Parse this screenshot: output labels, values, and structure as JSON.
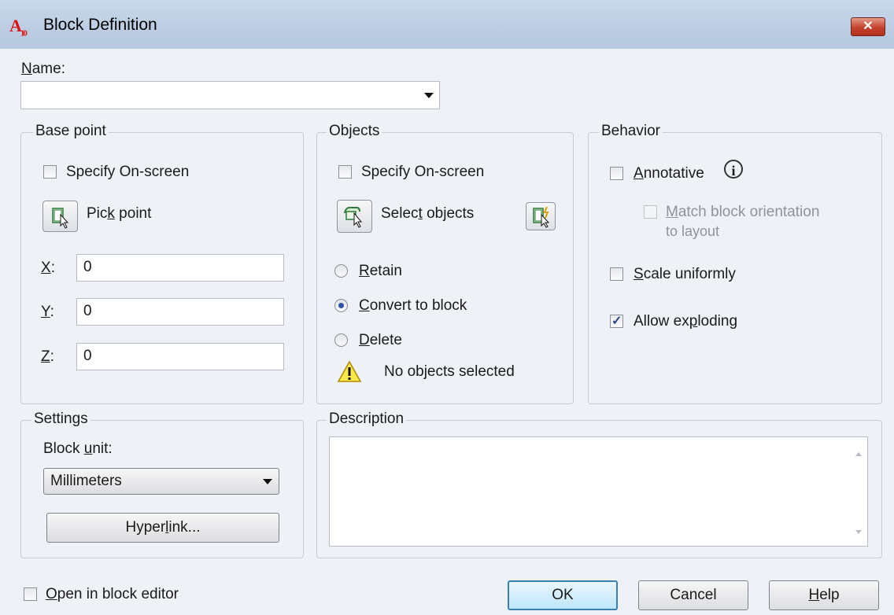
{
  "window": {
    "title": "Block Definition",
    "app_icon_text": "A",
    "app_icon_sub": "10",
    "close_symbol": "✕"
  },
  "name": {
    "label_pre": "",
    "label_u": "N",
    "label_post": "ame:",
    "value": ""
  },
  "base_point": {
    "title": "Base point",
    "specify_label": "Specify On-screen",
    "specify_checked": false,
    "pick_pre": "Pic",
    "pick_u": "k",
    "pick_post": " point",
    "x_u": "X",
    "x_post": ":",
    "x_value": "0",
    "y_u": "Y",
    "y_post": ":",
    "y_value": "0",
    "z_u": "Z",
    "z_post": ":",
    "z_value": "0"
  },
  "objects": {
    "title": "Objects",
    "specify_label": "Specify On-screen",
    "specify_checked": false,
    "select_pre": "Selec",
    "select_u": "t",
    "select_post": " objects",
    "retain_u": "R",
    "retain_post": "etain",
    "convert_u": "C",
    "convert_post": "onvert to block",
    "delete_u": "D",
    "delete_post": "elete",
    "selected_option": "convert",
    "status": "No objects selected"
  },
  "behavior": {
    "title": "Behavior",
    "annotative_u": "A",
    "annotative_post": "nnotative",
    "annotative_checked": false,
    "info_symbol": "i",
    "match_u": "M",
    "match_post": "atch block orientation",
    "match_line2": "to layout",
    "scale_u": "S",
    "scale_post": "cale uniformly",
    "scale_checked": false,
    "explode_pre": "Allow ex",
    "explode_u": "p",
    "explode_post": "loding",
    "explode_checked": true,
    "check_symbol": "✓"
  },
  "settings": {
    "title": "Settings",
    "unit_pre": "Block ",
    "unit_u": "u",
    "unit_post": "nit:",
    "unit_value": "Millimeters",
    "hyperlink_pre": "Hyper",
    "hyperlink_u": "l",
    "hyperlink_post": "ink..."
  },
  "description": {
    "title": "Description",
    "value": ""
  },
  "footer": {
    "open_u": "O",
    "open_post": "pen in block editor",
    "open_checked": false,
    "ok": "OK",
    "cancel": "Cancel",
    "help_u": "H",
    "help_post": "elp"
  }
}
